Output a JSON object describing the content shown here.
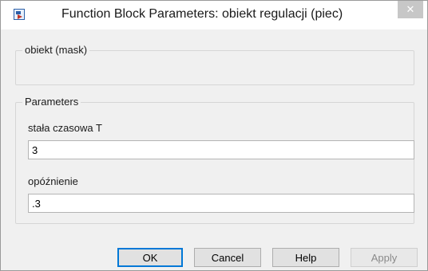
{
  "window": {
    "title": "Function Block Parameters: obiekt regulacji (piec)",
    "close_glyph": "✕",
    "icon": "simulink-block-icon"
  },
  "mask_group": {
    "legend": "obiekt (mask)"
  },
  "parameters_group": {
    "legend": "Parameters",
    "fields": [
      {
        "label": "stała czasowa T",
        "value": "3"
      },
      {
        "label": "opóźnienie",
        "value": ".3"
      }
    ]
  },
  "buttons": {
    "ok": "OK",
    "cancel": "Cancel",
    "help": "Help",
    "apply": "Apply"
  }
}
